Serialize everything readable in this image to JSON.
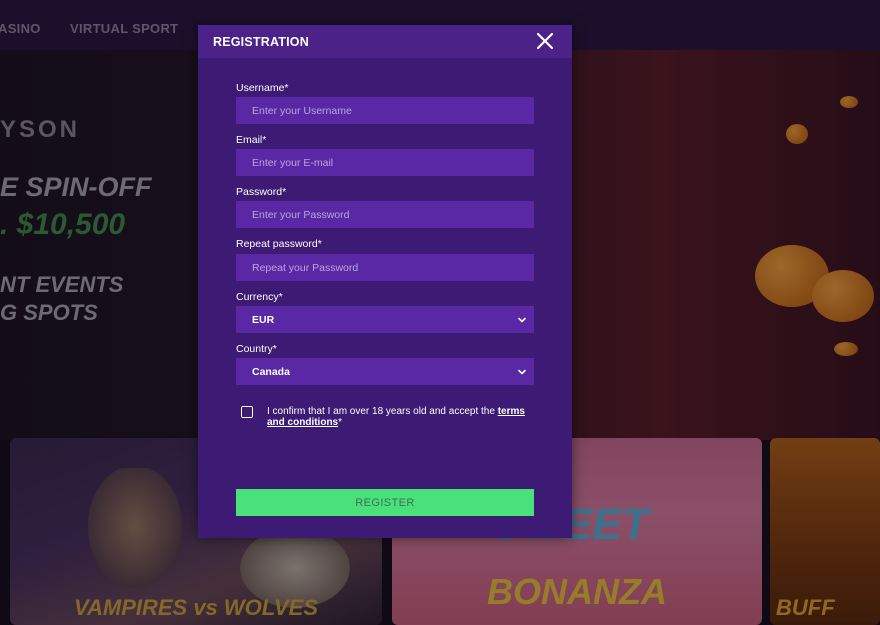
{
  "nav": {
    "items": [
      "ASINO",
      "VIRTUAL SPORT"
    ]
  },
  "hero": {
    "brand": "YSON",
    "line1": "E SPIN-OFF",
    "line2": ". $10,500",
    "line3": "NT EVENTS",
    "line4": "G SPOTS"
  },
  "games": [
    {
      "title": "VAMPIRES vs WOLVES"
    },
    {
      "title": "BONANZA",
      "sub": "SWEET"
    },
    {
      "title": "BUFF"
    }
  ],
  "modal": {
    "title": "REGISTRATION",
    "username": {
      "label": "Username*",
      "placeholder": "Enter your Username"
    },
    "email": {
      "label": "Email*",
      "placeholder": "Enter your E-mail"
    },
    "password": {
      "label": "Password*",
      "placeholder": "Enter your Password"
    },
    "repeat_password": {
      "label": "Repeat password*",
      "placeholder": "Repeat your Password"
    },
    "currency": {
      "label": "Currency*",
      "value": "EUR"
    },
    "country": {
      "label": "Country*",
      "value": "Canada"
    },
    "consent": {
      "text": "I confirm that I am over 18 years old and accept the",
      "link": "terms and conditions",
      "suffix": "*"
    },
    "register_label": "REGISTER"
  },
  "colors": {
    "modal_bg": "#3d1a73",
    "input_bg": "#5a28a4",
    "register_bg": "#4ae07a"
  }
}
